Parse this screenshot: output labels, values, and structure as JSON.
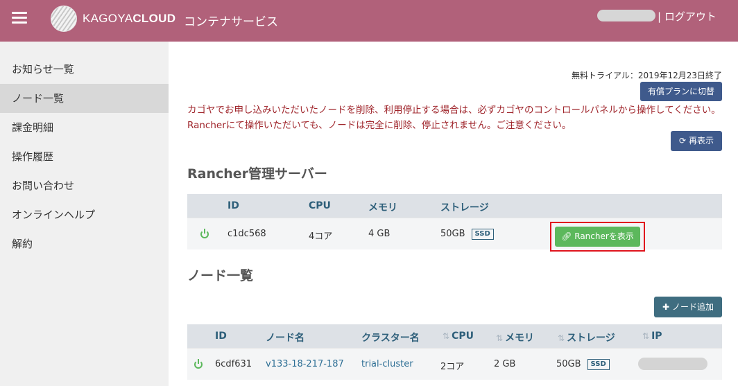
{
  "header": {
    "brand_light": "KAGOYA",
    "brand_bold": "CLOUD",
    "service": "コンテナサービス",
    "logout": "| ログアウト"
  },
  "sidebar": {
    "items": [
      {
        "label": "お知らせ一覧"
      },
      {
        "label": "ノード一覧",
        "active": true
      },
      {
        "label": "課金明細"
      },
      {
        "label": "操作履歴"
      },
      {
        "label": "お問い合わせ"
      },
      {
        "label": "オンラインヘルプ"
      },
      {
        "label": "解約"
      }
    ]
  },
  "main": {
    "trial_notice": "無料トライアル：2019年12月23日終了",
    "upgrade_label": "有償プランに切替",
    "warning": "カゴヤでお申し込みいただいたノードを削除、利用停止する場合は、必ずカゴヤのコントロールパネルから操作してください。 Rancherにて操作いただいても、ノードは完全に削除、停止されません。ご注意ください。",
    "refresh_label": "再表示",
    "rancher": {
      "title": "Rancher管理サーバー",
      "headers": {
        "id": "ID",
        "cpu": "CPU",
        "memory": "メモリ",
        "storage": "ストレージ"
      },
      "row": {
        "id": "c1dc568",
        "cpu": "4コア",
        "memory": "4 GB",
        "storage": "50GB",
        "storage_type": "SSD"
      },
      "open_label": "Rancherを表示"
    },
    "nodes": {
      "title": "ノード一覧",
      "add_label": "ノード追加",
      "headers": {
        "id": "ID",
        "name": "ノード名",
        "cluster": "クラスター名",
        "cpu": "CPU",
        "memory": "メモリ",
        "storage": "ストレージ",
        "ip": "IP"
      },
      "rows": [
        {
          "id": "6cdf631",
          "name": "v133-18-217-187",
          "cluster": "trial-cluster",
          "cpu": "2コア",
          "memory": "2 GB",
          "storage": "50GB",
          "storage_type": "SSD"
        }
      ]
    }
  },
  "colors": {
    "header_bg": "#b1617a",
    "primary_button": "#3f5a8c",
    "success_button": "#5cb85c",
    "warning_text": "#a0262c",
    "highlight_border": "#e0141d"
  }
}
